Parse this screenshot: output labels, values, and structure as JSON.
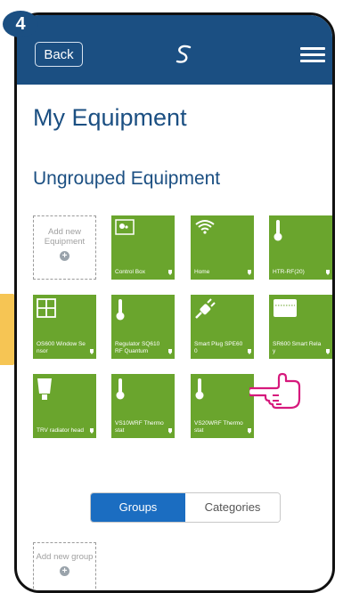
{
  "step": "4",
  "header": {
    "back_label": "Back",
    "logo_icon": "salus-logo-icon",
    "menu_icon": "hamburger-menu-icon"
  },
  "page_title": "My Equipment",
  "section_title": "Ungrouped Equipment",
  "add_equipment": {
    "label": "Add new Equipment",
    "icon": "plus-circle-icon"
  },
  "devices": [
    {
      "label": "Control Box",
      "icon": "control-box-icon"
    },
    {
      "label": "Home",
      "icon": "wifi-icon"
    },
    {
      "label": "HTR-RF(20)",
      "icon": "thermometer-icon"
    },
    {
      "label": "OS600 Window Sensor",
      "icon": "window-icon"
    },
    {
      "label": "Regulator SQ610 RF Quantum",
      "icon": "thermometer-icon"
    },
    {
      "label": "Smart Plug SPE600",
      "icon": "plug-icon"
    },
    {
      "label": "SR600 Smart Relay",
      "icon": "relay-icon"
    },
    {
      "label": "TRV radiator head",
      "icon": "trv-icon"
    },
    {
      "label": "VS10WRF Thermostat",
      "icon": "thermometer-icon"
    },
    {
      "label": "VS20WRF Thermostat",
      "icon": "thermometer-icon"
    }
  ],
  "tabs": {
    "groups_label": "Groups",
    "categories_label": "Categories",
    "active": "Groups"
  },
  "add_group": {
    "label": "Add new group",
    "icon": "plus-circle-icon"
  },
  "colors": {
    "header": "#1b4f82",
    "tile": "#6aa52d",
    "accent": "#1b6dc1",
    "pointer": "#d6197c",
    "hint_arrow": "#f6c554"
  }
}
